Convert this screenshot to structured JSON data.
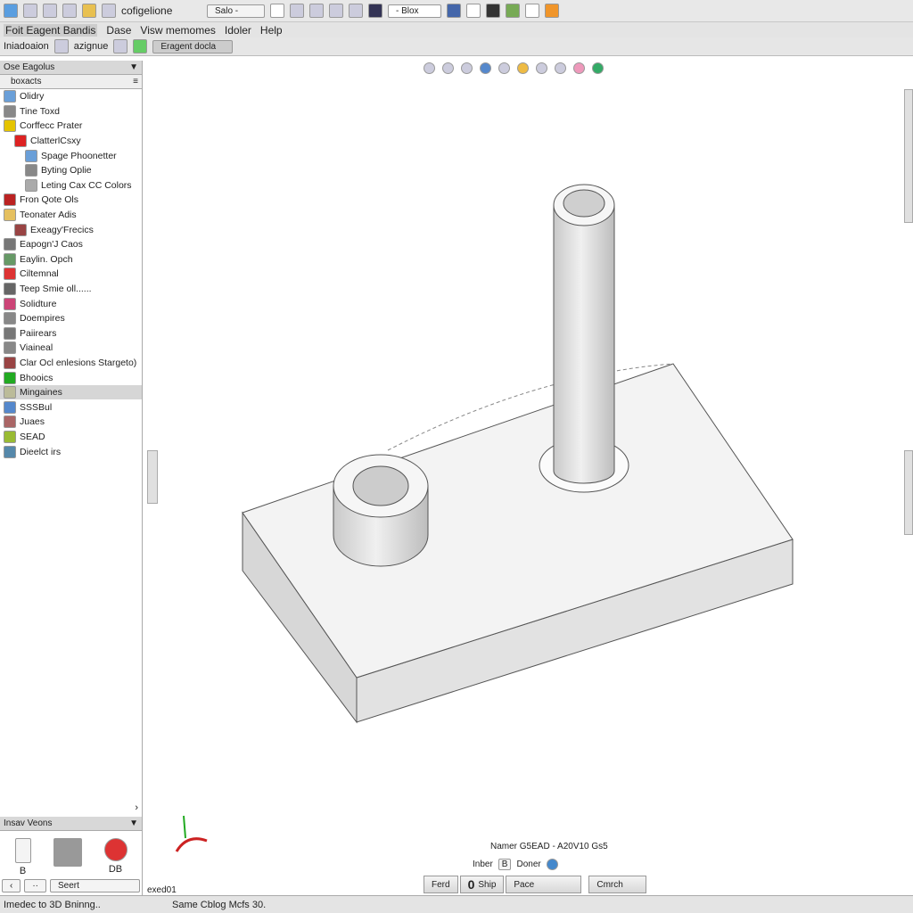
{
  "toolbar": {
    "config_label": "cofigelione",
    "field_value": "Salo -",
    "dropdown_value": "- Blox"
  },
  "menu": [
    "Foit Eagent Bandis",
    "Dase",
    "Visw memomes",
    "Idoler",
    "Help"
  ],
  "toolbar2": {
    "item1": "Iniadoaion",
    "item2": "azignue",
    "item3": "Eragent docla"
  },
  "sidebar": {
    "title": "Ose Eagolus",
    "subtitle": "boxacts",
    "items": [
      {
        "label": "Olidry",
        "indent": 0,
        "color": "#6a9fd8"
      },
      {
        "label": "Tine Toxd",
        "indent": 0,
        "color": "#888"
      },
      {
        "label": "Corffecc Prater",
        "indent": 0,
        "color": "#e5c400"
      },
      {
        "label": "ClatterlCsxy",
        "indent": 1,
        "color": "#d22"
      },
      {
        "label": "Spage Phoonetter",
        "indent": 2,
        "color": "#6a9fd8"
      },
      {
        "label": "Byting Oplie",
        "indent": 2,
        "color": "#888"
      },
      {
        "label": "Leting Cax CC Colors",
        "indent": 2,
        "color": "#aaa"
      },
      {
        "label": "Fron Qote Ols",
        "indent": 0,
        "color": "#b22"
      },
      {
        "label": "Teonater Adis",
        "indent": 0,
        "color": "#e5c060"
      },
      {
        "label": "Exeagy'Frecics",
        "indent": 1,
        "color": "#944"
      },
      {
        "label": "Eapogn'J Caos",
        "indent": 0,
        "color": "#777"
      },
      {
        "label": "Eaylin. Opch",
        "indent": 0,
        "color": "#696"
      },
      {
        "label": "Ciltemnal",
        "indent": 0,
        "color": "#d33"
      },
      {
        "label": "Teep Smie oll......",
        "indent": 0,
        "color": "#666"
      },
      {
        "label": "Solidture",
        "indent": 0,
        "color": "#c47"
      },
      {
        "label": "Doempires",
        "indent": 0,
        "color": "#888"
      },
      {
        "label": "Paiirears",
        "indent": 0,
        "color": "#777"
      },
      {
        "label": "Viaineal",
        "indent": 0,
        "color": "#888"
      },
      {
        "label": "Clar Ocl enlesions Stargeto)",
        "indent": 0,
        "color": "#944"
      },
      {
        "label": "Bhooics",
        "indent": 0,
        "color": "#2a2"
      },
      {
        "label": "Mingaines",
        "indent": 0,
        "color": "#bb9",
        "selected": true
      },
      {
        "label": "SSSBul",
        "indent": 0,
        "color": "#58c"
      },
      {
        "label": "Juaes",
        "indent": 0,
        "color": "#a66"
      },
      {
        "label": "SEAD",
        "indent": 0,
        "color": "#9b3"
      },
      {
        "label": "Dieelct irs",
        "indent": 0,
        "color": "#58a"
      }
    ]
  },
  "lower_panel": {
    "title": "Insav Veons",
    "icons": [
      {
        "label": "B"
      },
      {
        "label": ""
      },
      {
        "label": "DB"
      }
    ],
    "nav_label": "Seert"
  },
  "viewport": {
    "tab_label": "exed01",
    "info": "Namer G5EAD - A20V10 Gs5",
    "row2": {
      "label1": "Inber",
      "value": "B",
      "label2": "Doner"
    },
    "buttons": [
      "Ferd",
      "Ship",
      "Pace",
      "Cmrch"
    ],
    "button_prefix": "0"
  },
  "status": {
    "left": "Imedec to 3D Bninng..",
    "right": "Same Cblog Mcfs 30."
  }
}
